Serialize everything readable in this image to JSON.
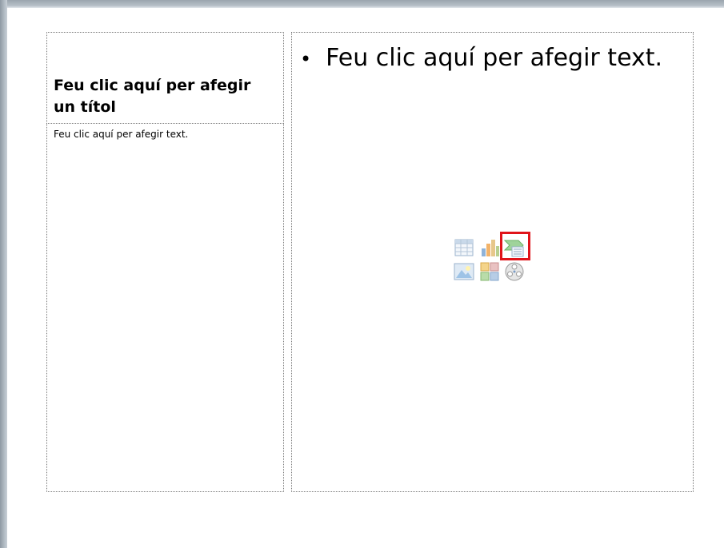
{
  "slide": {
    "title_placeholder": "Feu clic aquí per afegir un títol",
    "text_placeholder": "Feu clic aquí per afegir text.",
    "content_placeholder": {
      "bullet": "•",
      "text": "Feu clic aquí per afegir text."
    },
    "insert_icons": [
      "table-icon",
      "chart-icon",
      "smartart-icon",
      "picture-icon",
      "clipart-icon",
      "media-clip-icon"
    ],
    "highlighted_icon": "smartart-icon"
  },
  "colors": {
    "highlight": "#e0141a",
    "frame": "#a9b3bc"
  }
}
